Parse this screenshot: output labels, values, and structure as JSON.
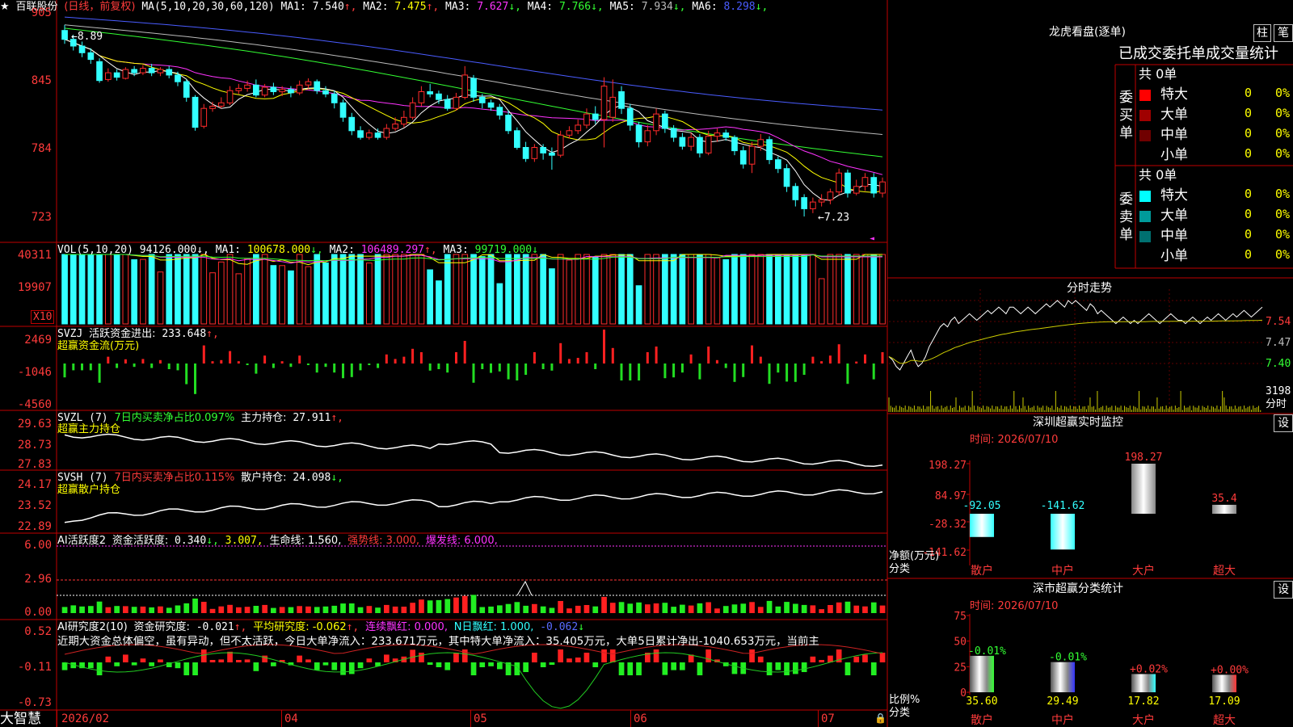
{
  "stock": {
    "name": "百联股份",
    "mode": "(日线，前复权)",
    "ma_params": "MA(5,10,20,30,60,120)",
    "ma": [
      {
        "label": "MA1:",
        "value": "7.540",
        "arrow": "↑",
        "color": "#ffffff"
      },
      {
        "label": "MA2:",
        "value": "7.475",
        "arrow": "↑",
        "color": "#ffff00"
      },
      {
        "label": "MA3:",
        "value": "7.627",
        "arrow": "↓",
        "color": "#ff33ff"
      },
      {
        "label": "MA4:",
        "value": "7.766",
        "arrow": "↓",
        "color": "#33ff33"
      },
      {
        "label": "MA5:",
        "value": "7.934",
        "arrow": "↓",
        "color": "#bbbbbb"
      },
      {
        "label": "MA6:",
        "value": "8.298",
        "arrow": "↓",
        "color": "#4a5cff"
      }
    ],
    "high_marker": "←8.89",
    "low_marker": "←7.23"
  },
  "price_axis": {
    "labels": [
      "905",
      "845",
      "784",
      "723"
    ],
    "values": [
      9.05,
      8.45,
      7.84,
      7.23
    ]
  },
  "candles": [
    {
      "o": 8.9,
      "c": 8.82,
      "h": 8.95,
      "l": 8.78
    },
    {
      "o": 8.82,
      "c": 8.76,
      "h": 8.86,
      "l": 8.72
    },
    {
      "o": 8.76,
      "c": 8.7,
      "h": 8.8,
      "l": 8.66
    },
    {
      "o": 8.7,
      "c": 8.64,
      "h": 8.74,
      "l": 8.6
    },
    {
      "o": 8.62,
      "c": 8.45,
      "h": 8.65,
      "l": 8.43
    },
    {
      "o": 8.46,
      "c": 8.52,
      "h": 8.56,
      "l": 8.44
    },
    {
      "o": 8.52,
      "c": 8.48,
      "h": 8.55,
      "l": 8.45
    },
    {
      "o": 8.47,
      "c": 8.55,
      "h": 8.57,
      "l": 8.46
    },
    {
      "o": 8.55,
      "c": 8.52,
      "h": 8.58,
      "l": 8.49
    },
    {
      "o": 8.52,
      "c": 8.56,
      "h": 8.59,
      "l": 8.5
    },
    {
      "o": 8.56,
      "c": 8.52,
      "h": 8.6,
      "l": 8.49
    },
    {
      "o": 8.52,
      "c": 8.55,
      "h": 8.57,
      "l": 8.49
    },
    {
      "o": 8.55,
      "c": 8.5,
      "h": 8.58,
      "l": 8.47
    },
    {
      "o": 8.5,
      "c": 8.44,
      "h": 8.53,
      "l": 8.4
    },
    {
      "o": 8.44,
      "c": 8.3,
      "h": 8.46,
      "l": 8.26
    },
    {
      "o": 8.3,
      "c": 8.03,
      "h": 8.32,
      "l": 8.0
    },
    {
      "o": 8.04,
      "c": 8.2,
      "h": 8.24,
      "l": 8.02
    },
    {
      "o": 8.2,
      "c": 8.22,
      "h": 8.26,
      "l": 8.17
    },
    {
      "o": 8.22,
      "c": 8.25,
      "h": 8.3,
      "l": 8.2
    },
    {
      "o": 8.25,
      "c": 8.36,
      "h": 8.4,
      "l": 8.23
    },
    {
      "o": 8.36,
      "c": 8.38,
      "h": 8.42,
      "l": 8.33
    },
    {
      "o": 8.38,
      "c": 8.41,
      "h": 8.45,
      "l": 8.35
    },
    {
      "o": 8.41,
      "c": 8.32,
      "h": 8.46,
      "l": 8.3
    },
    {
      "o": 8.32,
      "c": 8.39,
      "h": 8.42,
      "l": 8.3
    },
    {
      "o": 8.39,
      "c": 8.35,
      "h": 8.43,
      "l": 8.32
    },
    {
      "o": 8.35,
      "c": 8.37,
      "h": 8.4,
      "l": 8.31
    },
    {
      "o": 8.37,
      "c": 8.34,
      "h": 8.4,
      "l": 8.3
    },
    {
      "o": 8.34,
      "c": 8.41,
      "h": 8.45,
      "l": 8.32
    },
    {
      "o": 8.41,
      "c": 8.44,
      "h": 8.47,
      "l": 8.38
    },
    {
      "o": 8.44,
      "c": 8.36,
      "h": 8.46,
      "l": 8.33
    },
    {
      "o": 8.36,
      "c": 8.33,
      "h": 8.4,
      "l": 8.3
    },
    {
      "o": 8.33,
      "c": 8.25,
      "h": 8.36,
      "l": 8.2
    },
    {
      "o": 8.25,
      "c": 8.12,
      "h": 8.28,
      "l": 8.08
    },
    {
      "o": 8.12,
      "c": 8.0,
      "h": 8.16,
      "l": 7.96
    },
    {
      "o": 8.0,
      "c": 7.94,
      "h": 8.04,
      "l": 7.92
    },
    {
      "o": 7.94,
      "c": 7.98,
      "h": 8.01,
      "l": 7.92
    },
    {
      "o": 7.98,
      "c": 7.94,
      "h": 8.02,
      "l": 7.92
    },
    {
      "o": 7.94,
      "c": 8.02,
      "h": 8.06,
      "l": 7.92
    },
    {
      "o": 8.02,
      "c": 8.06,
      "h": 8.12,
      "l": 8.0
    },
    {
      "o": 8.06,
      "c": 8.12,
      "h": 8.18,
      "l": 8.03
    },
    {
      "o": 8.12,
      "c": 8.25,
      "h": 8.3,
      "l": 8.1
    },
    {
      "o": 8.25,
      "c": 8.35,
      "h": 8.4,
      "l": 8.22
    },
    {
      "o": 8.35,
      "c": 8.33,
      "h": 8.42,
      "l": 8.3
    },
    {
      "o": 8.33,
      "c": 8.28,
      "h": 8.36,
      "l": 8.24
    },
    {
      "o": 8.28,
      "c": 8.2,
      "h": 8.32,
      "l": 8.18
    },
    {
      "o": 8.2,
      "c": 8.3,
      "h": 8.34,
      "l": 8.18
    },
    {
      "o": 8.3,
      "c": 8.5,
      "h": 8.58,
      "l": 8.28
    },
    {
      "o": 8.47,
      "c": 8.3,
      "h": 8.5,
      "l": 8.26
    },
    {
      "o": 8.3,
      "c": 8.25,
      "h": 8.33,
      "l": 8.2
    },
    {
      "o": 8.25,
      "c": 8.21,
      "h": 8.28,
      "l": 8.18
    },
    {
      "o": 8.21,
      "c": 8.14,
      "h": 8.24,
      "l": 8.1
    },
    {
      "o": 8.14,
      "c": 8.0,
      "h": 8.18,
      "l": 7.97
    },
    {
      "o": 8.0,
      "c": 7.85,
      "h": 8.03,
      "l": 7.83
    },
    {
      "o": 7.85,
      "c": 7.75,
      "h": 7.9,
      "l": 7.72
    },
    {
      "o": 7.75,
      "c": 7.85,
      "h": 7.88,
      "l": 7.72
    },
    {
      "o": 7.85,
      "c": 7.8,
      "h": 7.88,
      "l": 7.74
    },
    {
      "o": 7.8,
      "c": 7.78,
      "h": 7.85,
      "l": 7.65
    },
    {
      "o": 7.78,
      "c": 7.96,
      "h": 8.0,
      "l": 7.76
    },
    {
      "o": 7.96,
      "c": 8.0,
      "h": 8.04,
      "l": 7.93
    },
    {
      "o": 8.0,
      "c": 8.05,
      "h": 8.1,
      "l": 7.97
    },
    {
      "o": 8.05,
      "c": 8.15,
      "h": 8.2,
      "l": 8.02
    },
    {
      "o": 8.15,
      "c": 8.1,
      "h": 8.22,
      "l": 8.06
    },
    {
      "o": 8.1,
      "c": 8.4,
      "h": 8.48,
      "l": 7.85
    },
    {
      "o": 8.12,
      "c": 8.3,
      "h": 8.46,
      "l": 8.08
    },
    {
      "o": 8.35,
      "c": 8.2,
      "h": 8.4,
      "l": 8.15
    },
    {
      "o": 8.2,
      "c": 8.05,
      "h": 8.24,
      "l": 8.0
    },
    {
      "o": 8.05,
      "c": 7.9,
      "h": 8.08,
      "l": 7.85
    },
    {
      "o": 7.9,
      "c": 8.0,
      "h": 8.05,
      "l": 7.86
    },
    {
      "o": 8.0,
      "c": 8.15,
      "h": 8.2,
      "l": 7.96
    },
    {
      "o": 8.15,
      "c": 8.02,
      "h": 8.18,
      "l": 7.98
    },
    {
      "o": 8.02,
      "c": 7.94,
      "h": 8.05,
      "l": 7.9
    },
    {
      "o": 7.94,
      "c": 7.86,
      "h": 7.98,
      "l": 7.83
    },
    {
      "o": 7.86,
      "c": 7.94,
      "h": 7.98,
      "l": 7.82
    },
    {
      "o": 7.94,
      "c": 7.8,
      "h": 7.97,
      "l": 7.76
    },
    {
      "o": 7.8,
      "c": 7.95,
      "h": 8.0,
      "l": 7.78
    },
    {
      "o": 7.95,
      "c": 7.98,
      "h": 8.02,
      "l": 7.9
    },
    {
      "o": 7.98,
      "c": 7.94,
      "h": 8.01,
      "l": 7.91
    },
    {
      "o": 7.94,
      "c": 7.82,
      "h": 7.96,
      "l": 7.78
    },
    {
      "o": 7.82,
      "c": 7.7,
      "h": 7.86,
      "l": 7.66
    },
    {
      "o": 7.7,
      "c": 7.86,
      "h": 7.9,
      "l": 7.62
    },
    {
      "o": 7.86,
      "c": 7.92,
      "h": 7.97,
      "l": 7.82
    },
    {
      "o": 7.92,
      "c": 7.74,
      "h": 7.95,
      "l": 7.7
    },
    {
      "o": 7.74,
      "c": 7.66,
      "h": 7.77,
      "l": 7.62
    },
    {
      "o": 7.66,
      "c": 7.5,
      "h": 7.7,
      "l": 7.45
    },
    {
      "o": 7.5,
      "c": 7.38,
      "h": 7.53,
      "l": 7.32
    },
    {
      "o": 7.4,
      "c": 7.3,
      "h": 7.43,
      "l": 7.23
    },
    {
      "o": 7.3,
      "c": 7.36,
      "h": 7.4,
      "l": 7.26
    },
    {
      "o": 7.36,
      "c": 7.38,
      "h": 7.43,
      "l": 7.32
    },
    {
      "o": 7.38,
      "c": 7.45,
      "h": 7.48,
      "l": 7.34
    },
    {
      "o": 7.45,
      "c": 7.62,
      "h": 7.66,
      "l": 7.42
    },
    {
      "o": 7.62,
      "c": 7.44,
      "h": 7.65,
      "l": 7.4
    },
    {
      "o": 7.44,
      "c": 7.5,
      "h": 7.56,
      "l": 7.42
    },
    {
      "o": 7.5,
      "c": 7.58,
      "h": 7.62,
      "l": 7.46
    },
    {
      "o": 7.58,
      "c": 7.44,
      "h": 7.62,
      "l": 7.4
    },
    {
      "o": 7.44,
      "c": 7.54,
      "h": 7.58,
      "l": 7.4
    }
  ],
  "vol": {
    "params": "VOL(5,10,20)",
    "value": "94126.000",
    "value_arrow": "↓,",
    "ma": [
      {
        "label": "MA1:",
        "value": "100678.000",
        "arrow": "↓,",
        "color": "#ffff00"
      },
      {
        "label": "MA2:",
        "value": "106489.297",
        "arrow": "↑,",
        "color": "#ff33ff"
      },
      {
        "label": "MA3:",
        "value": "99719.000",
        "arrow": "↓",
        "color": "#33ff33"
      }
    ],
    "axis": [
      "40311",
      "19907"
    ],
    "unit": "X10"
  },
  "svzj": {
    "title": "SVZJ",
    "label": "活跃资金进出:",
    "value": "233.648",
    "arrow": "↑,",
    "sub": "超赢资金流(万元)",
    "axis": [
      "2469",
      "-1046",
      "-4560"
    ]
  },
  "svzl": {
    "title": "SVZL (7)",
    "ratio": "7日内买卖净占比0.097%",
    "label": "主力持仓:",
    "value": "27.911",
    "arrow": "↑,",
    "sub": "超赢主力持仓",
    "axis": [
      "29.63",
      "28.73",
      "27.83"
    ]
  },
  "svsh": {
    "title": "SVSH (7)",
    "ratio": "7日内买卖净占比0.115%",
    "label": "散户持仓:",
    "value": "24.098",
    "arrow": "↓,",
    "sub": "超赢散户持仓",
    "axis": [
      "24.17",
      "23.52",
      "22.89"
    ]
  },
  "ai1": {
    "title": "AI活跃度2",
    "label": "资金活跃度:",
    "value": "0.340",
    "arrow": "↓,",
    "v2": "3.007,",
    "life": "生命线: 1.560,",
    "strong": "强势线: 3.000,",
    "burst": "爆发线: 6.000,",
    "axis": [
      "6.00",
      "2.96",
      "0.00"
    ]
  },
  "ai2": {
    "title": "AI研究度2(10)",
    "label": "资金研究度:",
    "value": "-0.021",
    "arrow": "↑,",
    "avg": "平均研究度: -0.062",
    "avg_arrow": "↑,",
    "cont": "连续飘红: 0.000,",
    "nday": "N日飘红: 1.000,",
    "nval": "-0.062",
    "nval_arrow": "↓",
    "comment": "近期大资金总体偏空，虽有异动，但不太活跃，今日大单净流入：233.671万元，其中特大单净流入：35.405万元，大单5日累计净出-1040.653万元，当前主",
    "axis": [
      "0.52",
      "-0.11",
      "-0.73"
    ]
  },
  "xaxis": {
    "labels": [
      "2026/02",
      "04",
      "05",
      "06",
      "07"
    ]
  },
  "brand": "大智慧",
  "lhb": {
    "title": "龙虎看盘(逐单)",
    "btn1": "柱",
    "btn2": "笔",
    "header": "已成交委托单成交量统计",
    "buy_label": "委买单",
    "sell_label": "委卖单",
    "buy_total": "共 0单",
    "sell_total": "共 0单",
    "buy_rows": [
      {
        "name": "特大",
        "count": "0",
        "pct": "0%",
        "color": "#ff0000"
      },
      {
        "name": "大单",
        "count": "0",
        "pct": "0%",
        "color": "#a00000"
      },
      {
        "name": "中单",
        "count": "0",
        "pct": "0%",
        "color": "#700000"
      },
      {
        "name": "小单",
        "count": "0",
        "pct": "0%",
        "color": ""
      }
    ],
    "sell_rows": [
      {
        "name": "特大",
        "count": "0",
        "pct": "0%",
        "color": "#00ffff"
      },
      {
        "name": "大单",
        "count": "0",
        "pct": "0%",
        "color": "#009a9a"
      },
      {
        "name": "中单",
        "count": "0",
        "pct": "0%",
        "color": "#007070"
      },
      {
        "name": "小单",
        "count": "0",
        "pct": "0%",
        "color": ""
      }
    ]
  },
  "intraday": {
    "title": "分时走势",
    "axis": [
      "7.54",
      "7.47",
      "7.40"
    ],
    "vol_label": "3198",
    "vol_unit": "分时",
    "prices": [
      7.43,
      7.42,
      7.4,
      7.39,
      7.41,
      7.43,
      7.45,
      7.42,
      7.4,
      7.41,
      7.43,
      7.46,
      7.48,
      7.5,
      7.52,
      7.53,
      7.52,
      7.54,
      7.55,
      7.53,
      7.54,
      7.55,
      7.56,
      7.55,
      7.54,
      7.55,
      7.56,
      7.57,
      7.56,
      7.57,
      7.58,
      7.57,
      7.56,
      7.58,
      7.58,
      7.57,
      7.56,
      7.57,
      7.58,
      7.57,
      7.56,
      7.57,
      7.58,
      7.59,
      7.58,
      7.59,
      7.6,
      7.59,
      7.58,
      7.6,
      7.59,
      7.6,
      7.59,
      7.58,
      7.57,
      7.59,
      7.58,
      7.56,
      7.57,
      7.56,
      7.55,
      7.54,
      7.53,
      7.54,
      7.55,
      7.54,
      7.53,
      7.54,
      7.53,
      7.54,
      7.55,
      7.56,
      7.55,
      7.54,
      7.53,
      7.54,
      7.55,
      7.56,
      7.55,
      7.54,
      7.54,
      7.53,
      7.54,
      7.55,
      7.54,
      7.53,
      7.54,
      7.55,
      7.54,
      7.55,
      7.56,
      7.55,
      7.54,
      7.55,
      7.56,
      7.55,
      7.56,
      7.57,
      7.56,
      7.55,
      7.56,
      7.57,
      7.58
    ]
  },
  "sz_monitor": {
    "title": "深圳超赢实时监控",
    "btn": "设",
    "time": "时间: 2026/07/10",
    "axis": [
      "198.27",
      "84.97",
      "-28.32",
      "-141.62"
    ],
    "ylabel": "净额(万元)",
    "xlabel": "分类",
    "bars": [
      {
        "name": "散户",
        "value": -92.05,
        "label": "-92.05"
      },
      {
        "name": "中户",
        "value": -141.62,
        "label": "-141.62"
      },
      {
        "name": "大户",
        "value": 198.27,
        "label": "198.27"
      },
      {
        "name": "超大",
        "value": 35.4,
        "label": "35.4"
      }
    ]
  },
  "sz_stats": {
    "title": "深市超赢分类统计",
    "btn": "设",
    "time": "时间: 2026/07/10",
    "axis": [
      "75",
      "50",
      "25",
      "0"
    ],
    "ylabel": "比例%",
    "xlabel": "分类",
    "bars": [
      {
        "name": "散户",
        "value": 35.6,
        "label": "35.60",
        "chg": "-0.01%",
        "color": "#33ff33"
      },
      {
        "name": "中户",
        "value": 29.49,
        "label": "29.49",
        "chg": "-0.01%",
        "color": "#3333ff"
      },
      {
        "name": "大户",
        "value": 17.82,
        "label": "17.82",
        "chg": "+0.02%",
        "color": "#33ffff"
      },
      {
        "name": "超大",
        "value": 17.09,
        "label": "17.09",
        "chg": "+0.00%",
        "color": "#ff3333"
      }
    ]
  }
}
